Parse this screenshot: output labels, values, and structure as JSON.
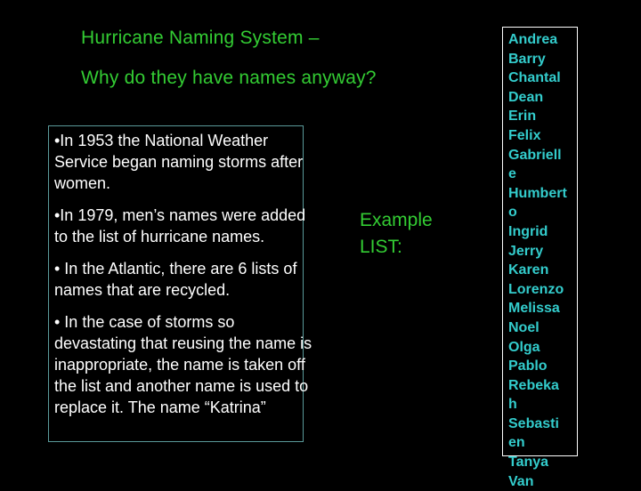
{
  "slide": {
    "title_line1": "Hurricane Naming System –",
    "title_line2": "Why do they have names anyway?",
    "bullets": [
      "•In 1953 the National Weather Service began naming storms after women.",
      "•In 1979, men’s names were added to the list of hurricane names.",
      "• In the Atlantic, there are 6 lists of names that are recycled.",
      "• In the case of storms so devastating that reusing the name is inappropriate, the name is taken off the list and another name is used to replace it.  The name “Katrina”"
    ],
    "example_line1": "Example",
    "example_line2": "LIST:",
    "names": [
      "Andrea",
      "Barry",
      "Chantal",
      "Dean",
      "Erin",
      "Felix",
      "Gabriell",
      "e",
      "Humbert",
      "o",
      "Ingrid",
      "Jerry",
      "Karen",
      "Lorenzo",
      "Melissa",
      "Noel",
      "Olga",
      "Pablo",
      "Rebeka",
      "h",
      "Sebasti",
      "en",
      "Tanya",
      "Van"
    ]
  },
  "colors": {
    "title": "#33cc33",
    "names": "#33cccc",
    "body": "#ffffff",
    "background": "#000000"
  }
}
